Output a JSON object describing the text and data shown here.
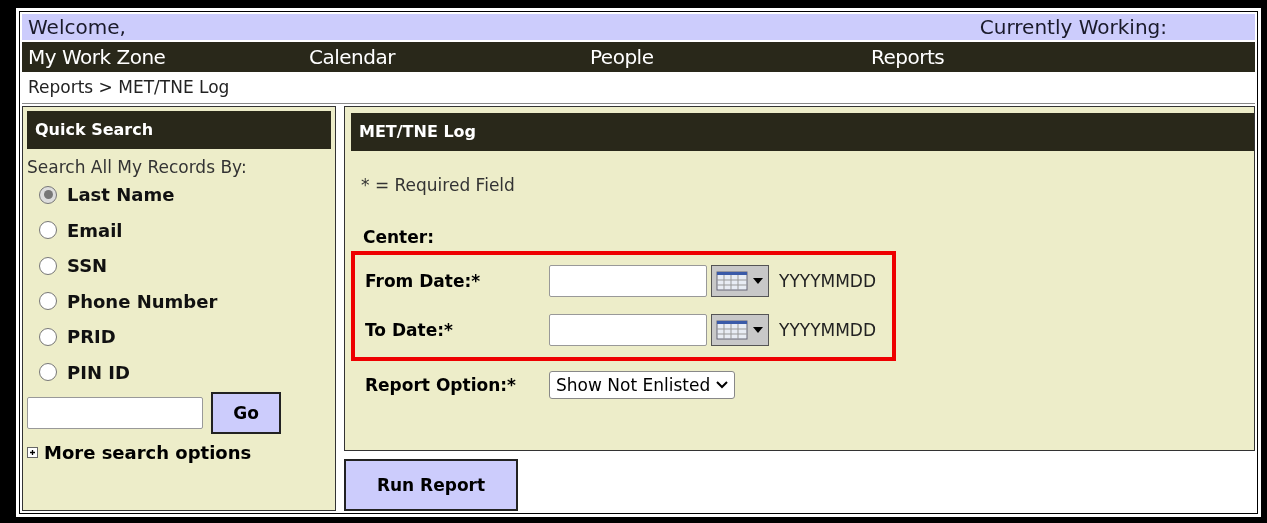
{
  "header": {
    "welcome": "Welcome,",
    "working": "Currently Working:"
  },
  "nav": [
    "My Work Zone",
    "Calendar",
    "People",
    "Reports"
  ],
  "breadcrumb": "Reports > MET/TNE Log",
  "quick_search": {
    "title": "Quick Search",
    "prompt": "Search All My Records By:",
    "options": [
      {
        "label": "Last Name",
        "selected": true
      },
      {
        "label": "Email",
        "selected": false
      },
      {
        "label": "SSN",
        "selected": false
      },
      {
        "label": "Phone Number",
        "selected": false
      },
      {
        "label": "PRID",
        "selected": false
      },
      {
        "label": "PIN ID",
        "selected": false
      }
    ],
    "button": "Go",
    "more": "More search options"
  },
  "report": {
    "title": "MET/TNE Log",
    "required_note": "* = Required Field",
    "center_label": "Center:",
    "date_group": {
      "highlighted": true,
      "fields": [
        {
          "label": "From Date:*",
          "format": "YYYYMMDD"
        },
        {
          "label": "To Date:*",
          "format": "YYYYMMDD"
        }
      ]
    },
    "option_label": "Report Option:*",
    "option_value": "Show Not Enlisted",
    "run_button": "Run Report"
  }
}
